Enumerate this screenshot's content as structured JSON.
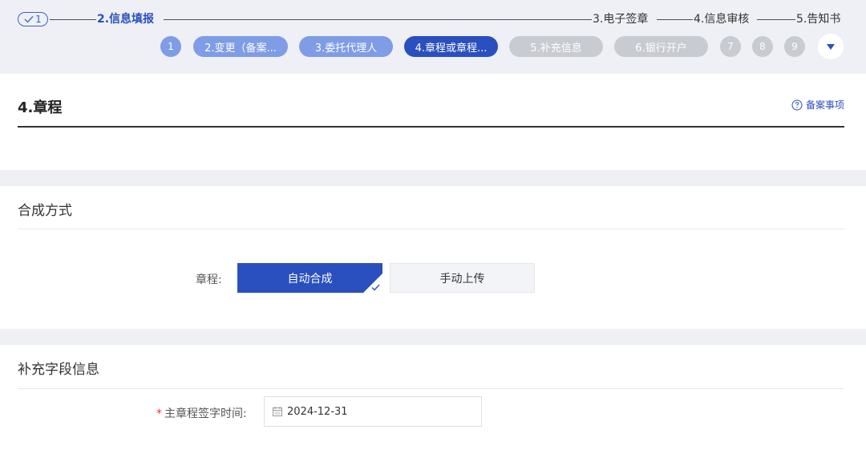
{
  "stepper": {
    "done_step": "1",
    "steps": [
      {
        "label": "2.信息填报"
      },
      {
        "label": "3.电子签章"
      },
      {
        "label": "4.信息审核"
      },
      {
        "label": "5.告知书"
      }
    ],
    "substeps": [
      {
        "label": "1"
      },
      {
        "label": "2.变更（备案..."
      },
      {
        "label": "3.委托代理人"
      },
      {
        "label": "4.章程或章程..."
      },
      {
        "label": "5.补充信息"
      },
      {
        "label": "6.银行开户"
      },
      {
        "label": "7"
      },
      {
        "label": "8"
      },
      {
        "label": "9"
      }
    ]
  },
  "section_main": {
    "title": "4.章程",
    "guide_link": "备案事项"
  },
  "section_compose": {
    "title": "合成方式",
    "field_label": "章程:",
    "option_selected": "自动合成",
    "option_other": "手动上传"
  },
  "section_extra": {
    "title": "补充字段信息",
    "required_mark": "*",
    "date_label": "主章程签字时间:",
    "date_value": "2024-12-31"
  },
  "colors": {
    "primary": "#2a4fbf",
    "light_blue": "#7f9ce6",
    "inactive": "#c8cbd2",
    "required": "#ee3333"
  }
}
